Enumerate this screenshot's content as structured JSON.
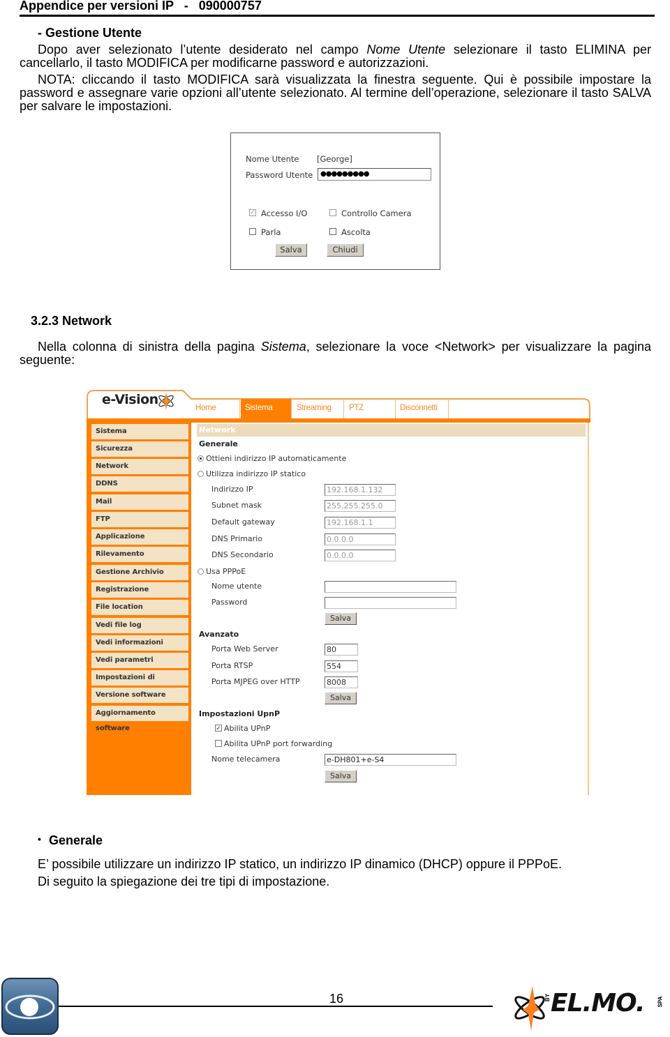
{
  "header": {
    "title": "Appendice per versioni IP   -   090000757"
  },
  "user_section": {
    "heading": "- Gestione Utente",
    "para1_before": "Dopo aver selezionato l’utente desiderato nel campo ",
    "para1_italic": "Nome Utente",
    "para1_after": " selezionare il tasto ELIMINA per cancellarlo, il tasto MODIFICA per modificarne  password e autorizzazioni.",
    "para2": "NOTA: cliccando il tasto MODIFICA sarà visualizzata la finestra seguente. Qui è possibile impostare la password e assegnare varie opzioni all’utente selezionato. Al termine dell’operazione, selezionare il tasto SALVA per salvare le impostazioni."
  },
  "user_dialog": {
    "name_label": "Nome Utente",
    "name_value": "[George]",
    "password_label": "Password Utente",
    "password_value": "●●●●●●●●●",
    "options": [
      {
        "label": "Accesso I/O",
        "checked": true,
        "disabled": true
      },
      {
        "label": "Controllo Camera",
        "checked": false,
        "disabled": true
      },
      {
        "label": "Parla",
        "checked": false,
        "disabled": false
      },
      {
        "label": "Ascolta",
        "checked": false,
        "disabled": false
      }
    ],
    "save_label": "Salva",
    "close_label": "Chiudi"
  },
  "network_section": {
    "heading": "3.2.3 Network",
    "para_before": "Nella colonna di sinistra della pagina ",
    "para_italic": "Sistema",
    "para_after": ", selezionare la voce <Network> per visualizzare la pagina seguente:"
  },
  "evision": {
    "logo": "e-Vision",
    "tabs": [
      {
        "label": "Home",
        "active": false
      },
      {
        "label": "Sistema",
        "active": true
      },
      {
        "label": "Streaming",
        "active": false
      },
      {
        "label": "PTZ",
        "active": false
      },
      {
        "label": "Disconnetti",
        "active": false
      }
    ],
    "sidebar": [
      "Sistema",
      "Sicurezza",
      "Network",
      "DDNS",
      "Mail",
      "FTP",
      "Applicazione",
      "Rilevamento Movimento",
      "Gestione Archivio",
      "Registrazione",
      "File location",
      "Vedi file log",
      "Vedi informazioni utenti",
      "Vedi parametri",
      "Impostazioni di fabbrica",
      "Versione software",
      "Aggiornamento software"
    ],
    "page_title": "Network",
    "generale": {
      "heading": "Generale",
      "radio_auto": "Ottieni indirizzo IP automaticamente",
      "radio_static": "Utilizza indirizzo IP statico",
      "selected": "auto",
      "fields": [
        {
          "label": "Indirizzo IP",
          "value": "192.168.1.132"
        },
        {
          "label": "Subnet mask",
          "value": "255.255.255.0"
        },
        {
          "label": "Default gateway",
          "value": "192.168.1.1"
        },
        {
          "label": "DNS Primario",
          "value": "0.0.0.0"
        },
        {
          "label": "DNS Secondario",
          "value": "0.0.0.0"
        }
      ],
      "radio_pppoe": "Usa PPPoE",
      "pppoe_user_label": "Nome utente",
      "pppoe_user_value": "",
      "pppoe_password_label": "Password",
      "pppoe_password_value": "",
      "save_label": "Salva"
    },
    "avanzato": {
      "heading": "Avanzato",
      "fields": [
        {
          "label": "Porta Web Server",
          "value": "80"
        },
        {
          "label": "Porta RTSP",
          "value": "554"
        },
        {
          "label": "Porta MJPEG over HTTP",
          "value": "8008"
        }
      ],
      "save_label": "Salva"
    },
    "upnp": {
      "heading": "Impostazioni UpnP",
      "enable_label": "Abilita UPnP",
      "enable_checked": true,
      "port_fwd_label": "Abilita UPnP port forwarding",
      "port_fwd_checked": false,
      "camera_name_label": "Nome telecamera",
      "camera_name_value": "e-DH801+e-S4",
      "save_label": "Salva"
    }
  },
  "generale_section": {
    "bullet": "•",
    "heading": "Generale",
    "line1": "E’ possibile utilizzare un indirizzo IP statico, un indirizzo IP dinamico (DHCP) oppure il PPPoE.",
    "line2": "Di seguito la spiegazione dei tre tipi di impostazione."
  },
  "footer": {
    "page_number": "16",
    "brand": "EL.MO.",
    "brand_by": "BY",
    "brand_spa": "SPA"
  },
  "colors": {
    "orange": "#ff7f00",
    "sidebar_item": "#f3e2c3",
    "title_bar": "#ecdcbd"
  }
}
